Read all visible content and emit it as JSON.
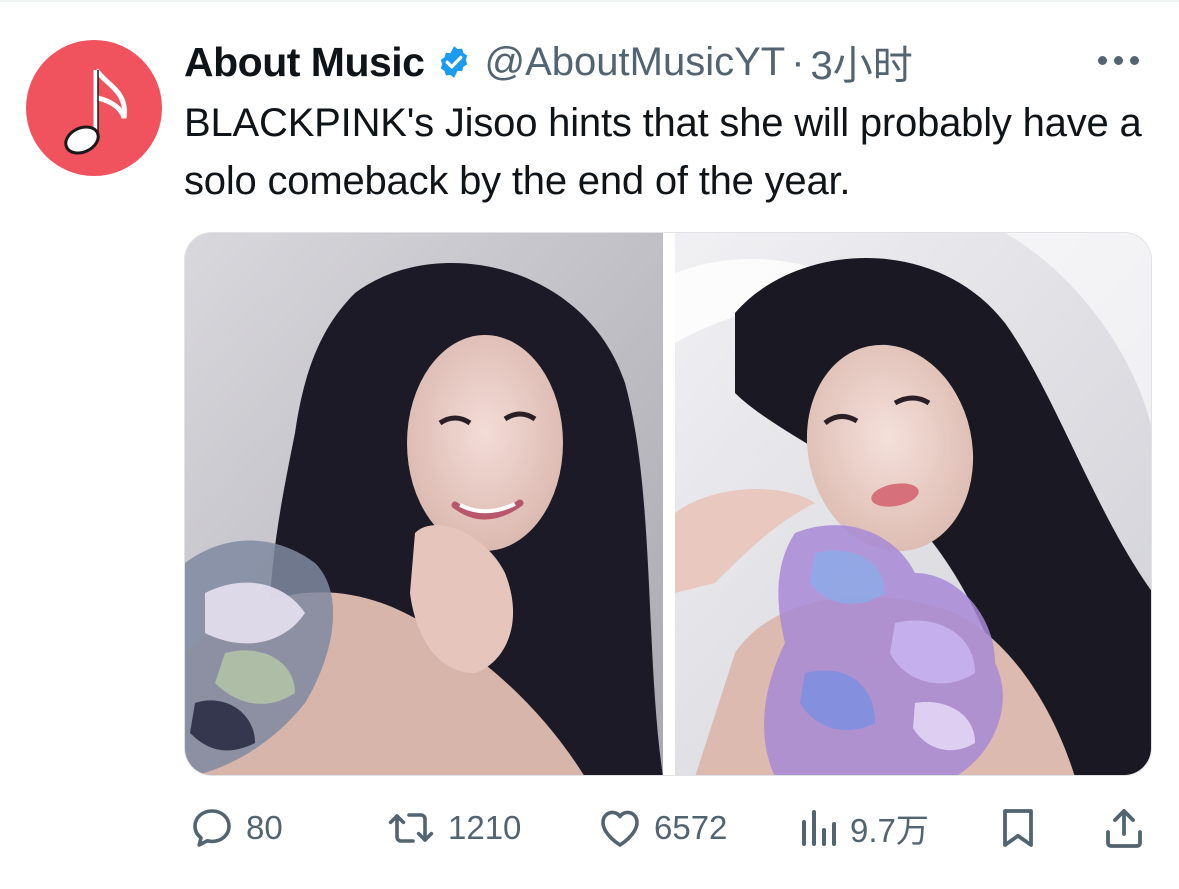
{
  "tweet": {
    "author": {
      "display_name": "About Music",
      "handle": "@AboutMusicYT",
      "verified": true,
      "avatar_icon": "music-note-icon",
      "avatar_color": "#f0525e"
    },
    "separator": "·",
    "time": "3小时",
    "more_icon": "more-dots-icon",
    "text": "BLACKPINK's Jisoo hints that she will probably have a solo comeback by the end of the year.",
    "media": [
      {
        "icon": "photo-image",
        "description_color": "#c9c8ce"
      },
      {
        "icon": "photo-image",
        "description_color": "#e9e9ee"
      }
    ],
    "actions": {
      "reply": {
        "icon": "reply-icon",
        "count": "80"
      },
      "repost": {
        "icon": "repost-icon",
        "count": "1210"
      },
      "like": {
        "icon": "heart-icon",
        "count": "6572"
      },
      "views": {
        "icon": "views-bar-chart-icon",
        "count": "9.7万"
      },
      "bookmark": {
        "icon": "bookmark-icon"
      },
      "share": {
        "icon": "share-icon"
      }
    }
  },
  "colors": {
    "text": "#0f1419",
    "secondary": "#536471",
    "verified_blue": "#1d9bf0"
  }
}
